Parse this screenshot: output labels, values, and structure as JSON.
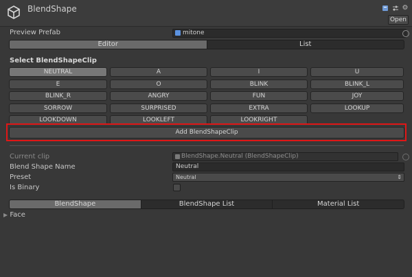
{
  "window": {
    "title": "BlendShape",
    "open_label": "Open"
  },
  "preview": {
    "label": "Preview Prefab",
    "value": "mitone"
  },
  "top_tabs": [
    {
      "label": "Editor",
      "active": true
    },
    {
      "label": "List",
      "active": false
    }
  ],
  "section_title": "Select BlendShapeClip",
  "clips": [
    [
      "NEUTRAL",
      "A",
      "I",
      "U"
    ],
    [
      "E",
      "O",
      "BLINK",
      "BLINK_L"
    ],
    [
      "BLINK_R",
      "ANGRY",
      "FUN",
      "JOY"
    ],
    [
      "SORROW",
      "SURPRISED",
      "EXTRA",
      "LOOKUP"
    ],
    [
      "LOOKDOWN",
      "LOOKLEFT",
      "LOOKRIGHT"
    ]
  ],
  "selected_clip": "NEUTRAL",
  "add_button_label": "Add BlendShapeClip",
  "current_clip": {
    "label": "Current clip",
    "value": "BlendShape.Neutral (BlendShapeClip)"
  },
  "blend_shape_name": {
    "label": "Blend Shape Name",
    "value": "Neutral"
  },
  "preset": {
    "label": "Preset",
    "value": "Neutral"
  },
  "is_binary": {
    "label": "Is Binary",
    "checked": false
  },
  "bottom_tabs": [
    {
      "label": "BlendShape",
      "active": true
    },
    {
      "label": "BlendShape List",
      "active": false
    },
    {
      "label": "Material List",
      "active": false
    }
  ],
  "face_foldout": {
    "label": "Face",
    "expanded": false
  },
  "colors": {
    "background": "#383838",
    "highlight": "#e11616",
    "active_tab": "#6a6a6a"
  }
}
